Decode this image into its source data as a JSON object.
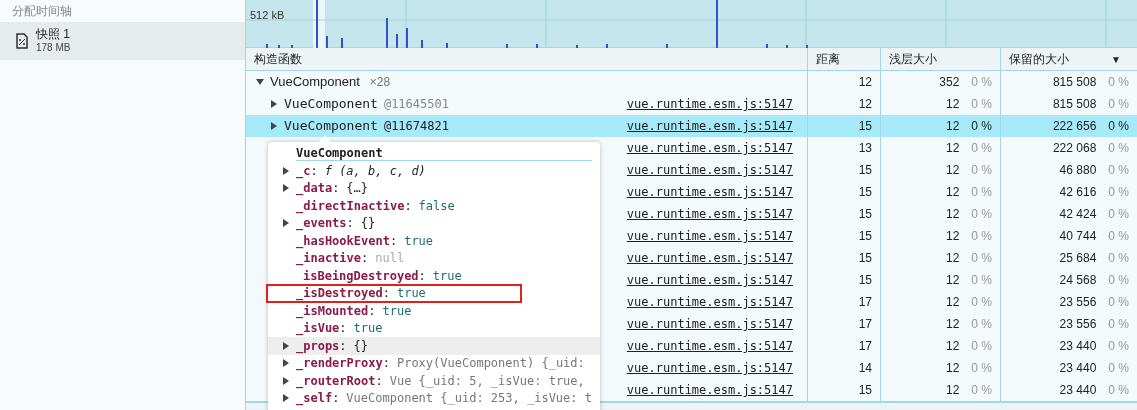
{
  "sidebar": {
    "section_title": "分配时间轴",
    "items": [
      {
        "title": "快照 1",
        "subtitle": "178 MB",
        "selected": true
      }
    ]
  },
  "timeline": {
    "axis_label": "512 kB"
  },
  "table": {
    "columns": [
      "构造函数",
      "距离",
      "浅层大小",
      "保留的大小"
    ],
    "sort_indicator": "▼",
    "group": {
      "name": "VueComponent",
      "count": "×28",
      "expanded": true,
      "distance": "12",
      "shallow": "352",
      "shallow_pct": "0 %",
      "retained": "815 508",
      "retained_pct": "0 %"
    },
    "rows": [
      {
        "name": "VueComponent",
        "id": "@11645501",
        "source": "vue.runtime.esm.js:5147",
        "distance": "12",
        "shallow": "12",
        "shallow_pct": "0 %",
        "retained": "815 508",
        "retained_pct": "0 %",
        "selected": false
      },
      {
        "name": "VueComponent",
        "id": "@11674821",
        "source": "vue.runtime.esm.js:5147",
        "distance": "15",
        "shallow": "12",
        "shallow_pct": "0 %",
        "retained": "222 656",
        "retained_pct": "0 %",
        "selected": true
      },
      {
        "source": "vue.runtime.esm.js:5147",
        "distance": "13",
        "shallow": "12",
        "shallow_pct": "0 %",
        "retained": "222 068",
        "retained_pct": "0 %",
        "selected": false
      },
      {
        "source": "vue.runtime.esm.js:5147",
        "distance": "15",
        "shallow": "12",
        "shallow_pct": "0 %",
        "retained": "46 880",
        "retained_pct": "0 %",
        "selected": false
      },
      {
        "source": "vue.runtime.esm.js:5147",
        "distance": "15",
        "shallow": "12",
        "shallow_pct": "0 %",
        "retained": "42 616",
        "retained_pct": "0 %",
        "selected": false
      },
      {
        "source": "vue.runtime.esm.js:5147",
        "distance": "15",
        "shallow": "12",
        "shallow_pct": "0 %",
        "retained": "42 424",
        "retained_pct": "0 %",
        "selected": false
      },
      {
        "source": "vue.runtime.esm.js:5147",
        "distance": "15",
        "shallow": "12",
        "shallow_pct": "0 %",
        "retained": "40 744",
        "retained_pct": "0 %",
        "selected": false
      },
      {
        "source": "vue.runtime.esm.js:5147",
        "distance": "15",
        "shallow": "12",
        "shallow_pct": "0 %",
        "retained": "25 684",
        "retained_pct": "0 %",
        "selected": false
      },
      {
        "source": "vue.runtime.esm.js:5147",
        "distance": "15",
        "shallow": "12",
        "shallow_pct": "0 %",
        "retained": "24 568",
        "retained_pct": "0 %",
        "selected": false
      },
      {
        "source": "vue.runtime.esm.js:5147",
        "distance": "17",
        "shallow": "12",
        "shallow_pct": "0 %",
        "retained": "23 556",
        "retained_pct": "0 %",
        "selected": false
      },
      {
        "source": "vue.runtime.esm.js:5147",
        "distance": "17",
        "shallow": "12",
        "shallow_pct": "0 %",
        "retained": "23 556",
        "retained_pct": "0 %",
        "selected": false
      },
      {
        "source": "vue.runtime.esm.js:5147",
        "distance": "17",
        "shallow": "12",
        "shallow_pct": "0 %",
        "retained": "23 440",
        "retained_pct": "0 %",
        "selected": false
      },
      {
        "source": "vue.runtime.esm.js:5147",
        "distance": "14",
        "shallow": "12",
        "shallow_pct": "0 %",
        "retained": "23 440",
        "retained_pct": "0 %",
        "selected": false
      },
      {
        "source": "vue.runtime.esm.js:5147",
        "distance": "15",
        "shallow": "12",
        "shallow_pct": "0 %",
        "retained": "23 440",
        "retained_pct": "0 %",
        "selected": false
      }
    ]
  },
  "popover": {
    "title": "VueComponent",
    "properties": [
      {
        "key": "_c",
        "separator": ":",
        "value": "f (a, b, c, d)",
        "kind": "function",
        "expandable": true,
        "hovered": false,
        "highlighted": false
      },
      {
        "key": "_data",
        "separator": ":",
        "value": "{…}",
        "kind": "object",
        "expandable": true,
        "hovered": false,
        "highlighted": false
      },
      {
        "key": "_directInactive",
        "separator": ":",
        "value": "false",
        "kind": "boolean",
        "expandable": false,
        "hovered": false,
        "highlighted": false
      },
      {
        "key": "_events",
        "separator": ":",
        "value": "{}",
        "kind": "object",
        "expandable": true,
        "hovered": false,
        "highlighted": false
      },
      {
        "key": "_hasHookEvent",
        "separator": ":",
        "value": "true",
        "kind": "boolean",
        "expandable": false,
        "hovered": false,
        "highlighted": false
      },
      {
        "key": "_inactive",
        "separator": ":",
        "value": "null",
        "kind": "null",
        "expandable": false,
        "hovered": false,
        "highlighted": false
      },
      {
        "key": "isBeingDestroyed",
        "separator": ":",
        "value": "true",
        "kind": "boolean",
        "expandable": false,
        "hovered": false,
        "highlighted": false
      },
      {
        "key": "_isDestroyed",
        "separator": ":",
        "value": "true",
        "kind": "boolean",
        "expandable": false,
        "hovered": false,
        "highlighted": true
      },
      {
        "key": "_isMounted",
        "separator": ":",
        "value": "true",
        "kind": "boolean",
        "expandable": false,
        "hovered": false,
        "highlighted": false
      },
      {
        "key": "_isVue",
        "separator": ":",
        "value": "true",
        "kind": "boolean",
        "expandable": false,
        "hovered": false,
        "highlighted": false
      },
      {
        "key": "_props",
        "separator": ":",
        "value": "{}",
        "kind": "object",
        "expandable": true,
        "hovered": true,
        "highlighted": false
      },
      {
        "key": "_renderProxy",
        "separator": ":",
        "value": "Proxy(VueComponent) {_uid:",
        "kind": "preview",
        "expandable": true,
        "hovered": false,
        "highlighted": false
      },
      {
        "key": "_routerRoot",
        "separator": ":",
        "value": "Vue {_uid: 5, _isVue: true,",
        "kind": "preview",
        "expandable": true,
        "hovered": false,
        "highlighted": false
      },
      {
        "key": "_self",
        "separator": ":",
        "value": "VueComponent {_uid: 253, _isVue: t",
        "kind": "preview",
        "expandable": true,
        "hovered": false,
        "highlighted": false
      }
    ]
  }
}
